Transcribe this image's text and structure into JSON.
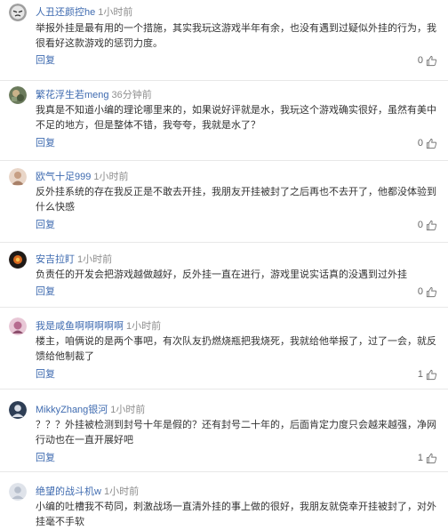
{
  "comments": [
    {
      "username": "人丑还颜控he",
      "time": "1小时前",
      "text": "举报外挂是最有用的一个措施，其实我玩这游戏半年有余，也没有遇到过疑似外挂的行为，我很看好这款游戏的惩罚力度。",
      "reply": "回复",
      "likes": "0",
      "avatar": "face-sad-avatar"
    },
    {
      "username": "繁花浮生若meng",
      "time": "36分钟前",
      "text": "我真是不知道小编的理论哪里来的，如果说好评就是水，我玩这个游戏确实很好，虽然有美中不足的地方，但是整体不错，我夸夸，我就是水了？",
      "reply": "回复",
      "likes": "0",
      "avatar": "photo-avatar"
    },
    {
      "username": "欧气十足999",
      "time": "1小时前",
      "text": "反外挂系统的存在我反正是不敢去开挂，我朋友开挂被封了之后再也不去开了，他都没体验到什么快感",
      "reply": "回复",
      "likes": "0",
      "avatar": "figure-avatar"
    },
    {
      "username": "安吉拉盯",
      "time": "1小时前",
      "text": "负责任的开发会把游戏越做越好，反外挂一直在进行，游戏里说实话真的没遇到过外挂",
      "reply": "回复",
      "likes": "0",
      "avatar": "dark-avatar"
    },
    {
      "username": "我是咸鱼啊啊啊啊啊",
      "time": "1小时前",
      "text": "楼主，咱俩说的是两个事吧，有次队友扔燃烧瓶把我烧死，我就给他举报了，过了一会，就反馈给他制裁了",
      "reply": "回复",
      "likes": "1",
      "avatar": "pink-avatar"
    },
    {
      "username": "MikkyZhang银河",
      "time": "1小时前",
      "text": "？？？外挂被检测到封号十年是假的？还有封号二十年的，后面肯定力度只会越来越强，净网行动也在一直开展好吧",
      "reply": "回复",
      "likes": "1",
      "avatar": "person-avatar"
    },
    {
      "username": "绝望的战斗机w",
      "time": "1小时前",
      "text": "小编的吐槽我不苟同，刺激战场一直清外挂的事上做的很好，我朋友就侥幸开挂被封了，对外挂毫不手软",
      "reply": "",
      "likes": "",
      "avatar": "light-avatar"
    }
  ],
  "colors": {
    "username": "#3f6bb0",
    "time": "#8e8e8e",
    "text": "#333333",
    "divider": "#e8e8e8"
  }
}
